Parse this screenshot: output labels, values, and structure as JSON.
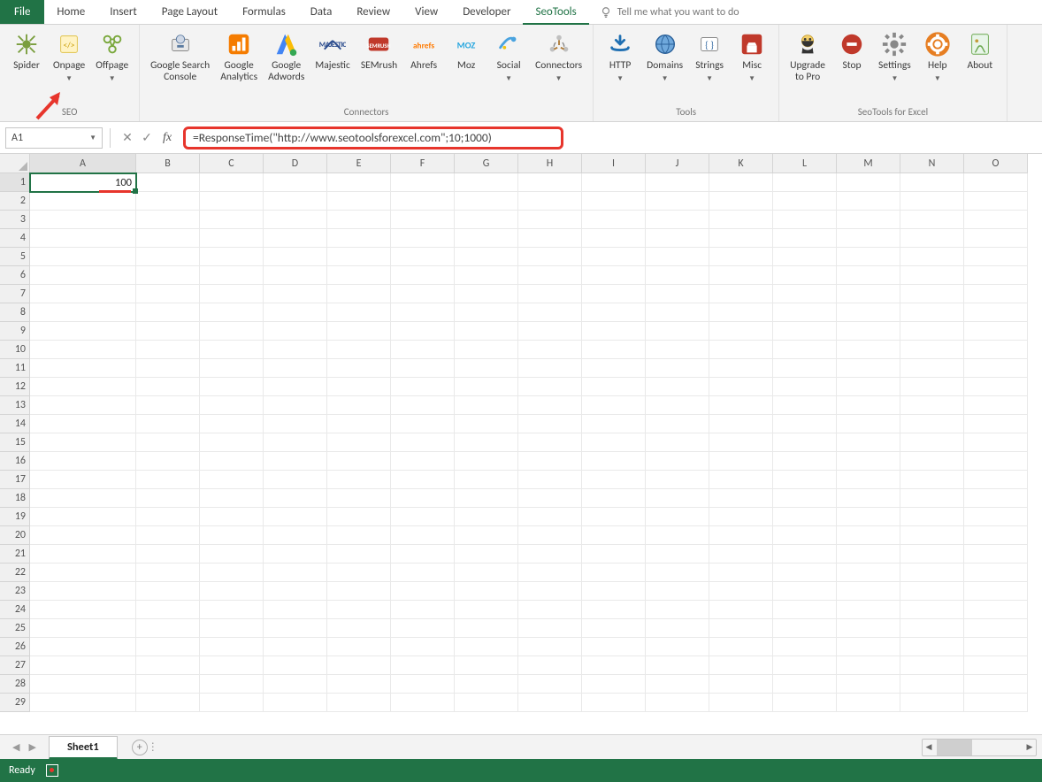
{
  "tabs": {
    "file": "File",
    "list": [
      "Home",
      "Insert",
      "Page Layout",
      "Formulas",
      "Data",
      "Review",
      "View",
      "Developer",
      "SeoTools"
    ],
    "active": "SeoTools",
    "tellme": "Tell me what you want to do"
  },
  "ribbon": {
    "groups": [
      {
        "label": "SEO",
        "buttons": [
          {
            "name": "spider",
            "label": "Spider",
            "dd": false
          },
          {
            "name": "onpage",
            "label": "Onpage",
            "dd": true
          },
          {
            "name": "offpage",
            "label": "Offpage",
            "dd": true
          }
        ]
      },
      {
        "label": "Connectors",
        "buttons": [
          {
            "name": "google-search-console",
            "label": "Google Search\nConsole",
            "dd": false
          },
          {
            "name": "google-analytics",
            "label": "Google\nAnalytics",
            "dd": false
          },
          {
            "name": "google-adwords",
            "label": "Google\nAdwords",
            "dd": false
          },
          {
            "name": "majestic",
            "label": "Majestic",
            "dd": false
          },
          {
            "name": "semrush",
            "label": "SEMrush",
            "dd": false
          },
          {
            "name": "ahrefs",
            "label": "Ahrefs",
            "dd": false
          },
          {
            "name": "moz",
            "label": "Moz",
            "dd": false
          },
          {
            "name": "social",
            "label": "Social",
            "dd": true
          },
          {
            "name": "connectors",
            "label": "Connectors",
            "dd": true
          }
        ]
      },
      {
        "label": "Tools",
        "buttons": [
          {
            "name": "http",
            "label": "HTTP",
            "dd": true
          },
          {
            "name": "domains",
            "label": "Domains",
            "dd": true
          },
          {
            "name": "strings",
            "label": "Strings",
            "dd": true
          },
          {
            "name": "misc",
            "label": "Misc",
            "dd": true
          }
        ]
      },
      {
        "label": "SeoTools for Excel",
        "buttons": [
          {
            "name": "upgrade",
            "label": "Upgrade\nto Pro",
            "dd": false
          },
          {
            "name": "stop",
            "label": "Stop",
            "dd": false
          },
          {
            "name": "settings",
            "label": "Settings",
            "dd": true
          },
          {
            "name": "help",
            "label": "Help",
            "dd": true
          },
          {
            "name": "about",
            "label": "About",
            "dd": false
          }
        ]
      }
    ]
  },
  "formula_bar": {
    "namebox": "A1",
    "formula": "=ResponseTime(\"http://www.seotoolsforexcel.com\";10;1000)"
  },
  "grid": {
    "columns": [
      "A",
      "B",
      "C",
      "D",
      "E",
      "F",
      "G",
      "H",
      "I",
      "J",
      "K",
      "L",
      "M",
      "N",
      "O"
    ],
    "rows": 29,
    "active_cell": "A1",
    "cells": {
      "A1": "100"
    }
  },
  "sheet": {
    "name": "Sheet1"
  },
  "status": {
    "text": "Ready"
  }
}
